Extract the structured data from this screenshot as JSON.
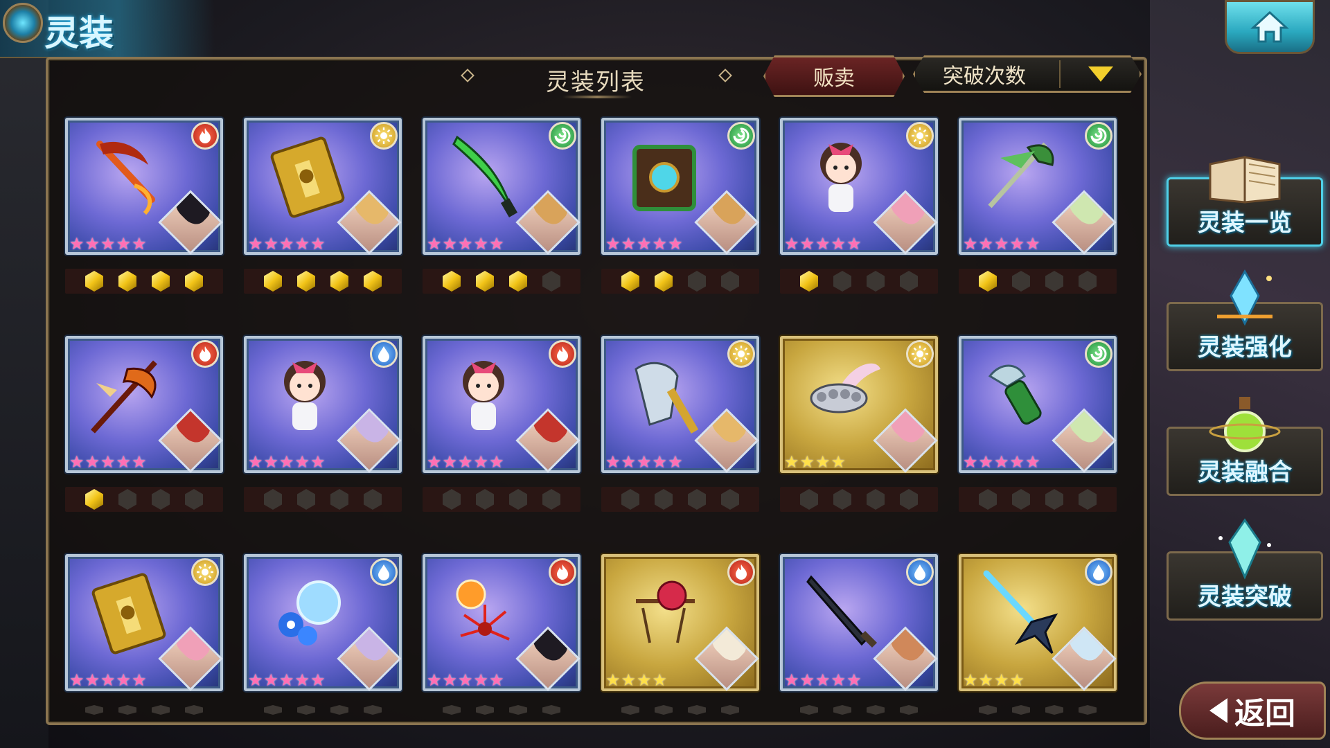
{
  "header": {
    "title": "灵装"
  },
  "list": {
    "title": "灵装列表",
    "sell_label": "贩卖",
    "sort_label": "突破次数"
  },
  "side_menu": [
    {
      "label": "灵装一览",
      "icon": "book-icon",
      "active": true
    },
    {
      "label": "灵装强化",
      "icon": "crystal-enhance-icon",
      "active": false
    },
    {
      "label": "灵装融合",
      "icon": "potion-flask-icon",
      "active": false
    },
    {
      "label": "灵装突破",
      "icon": "crystal-break-icon",
      "active": false
    }
  ],
  "back_label": "返回",
  "colors": {
    "fire": "#c73222",
    "light": "#e0a820",
    "wind": "#2a9a44",
    "water": "#2a6fd0",
    "gem": "#f2c418"
  },
  "cards": [
    {
      "item": "flame-scythe",
      "element": "fire",
      "rarity": 5,
      "frame": "purple",
      "breakthrough": 4,
      "hair": "#1e1a22"
    },
    {
      "item": "golden-tome",
      "element": "light",
      "rarity": 5,
      "frame": "purple",
      "breakthrough": 4,
      "hair": "#e6b86a"
    },
    {
      "item": "green-blade",
      "element": "wind",
      "rarity": 5,
      "frame": "purple",
      "breakthrough": 3,
      "hair": "#d9a35a"
    },
    {
      "item": "emerald-grimoire",
      "element": "wind",
      "rarity": 5,
      "frame": "purple",
      "breakthrough": 2,
      "hair": "#d9a35a"
    },
    {
      "item": "ribbon-doll",
      "element": "light",
      "rarity": 5,
      "frame": "purple",
      "breakthrough": 1,
      "hair": "#f0a0b8"
    },
    {
      "item": "jade-glaive",
      "element": "wind",
      "rarity": 5,
      "frame": "purple",
      "breakthrough": 1,
      "hair": "#cfe7b0"
    },
    {
      "item": "crimson-halberd",
      "element": "fire",
      "rarity": 5,
      "frame": "purple",
      "breakthrough": 1,
      "hair": "#c4352c"
    },
    {
      "item": "ribbon-doll",
      "element": "water",
      "rarity": 5,
      "frame": "purple",
      "breakthrough": 0,
      "hair": "#c9b4e6"
    },
    {
      "item": "ribbon-doll",
      "element": "fire",
      "rarity": 5,
      "frame": "purple",
      "breakthrough": 0,
      "hair": "#c4352c"
    },
    {
      "item": "golden-gauntlet",
      "element": "light",
      "rarity": 5,
      "frame": "purple",
      "breakthrough": 0,
      "hair": "#e6b86a"
    },
    {
      "item": "winged-knuckles",
      "element": "light",
      "rarity": 4,
      "frame": "gold",
      "breakthrough": 0,
      "hair": "#f0a0b8"
    },
    {
      "item": "shark-blaster",
      "element": "wind",
      "rarity": 5,
      "frame": "purple",
      "breakthrough": 0,
      "hair": "#cfe7b0"
    },
    {
      "item": "golden-tome",
      "element": "light",
      "rarity": 5,
      "frame": "purple",
      "breakthrough": null,
      "hair": "#f0a0b8"
    },
    {
      "item": "morning-glory-orb",
      "element": "water",
      "rarity": 5,
      "frame": "purple",
      "breakthrough": null,
      "hair": "#c9b4e6"
    },
    {
      "item": "spider-lily-orb",
      "element": "fire",
      "rarity": 5,
      "frame": "purple",
      "breakthrough": null,
      "hair": "#1e1a22"
    },
    {
      "item": "rose-staff",
      "element": "fire",
      "rarity": 4,
      "frame": "gold",
      "breakthrough": null,
      "hair": "#f3ead8"
    },
    {
      "item": "dark-greatsword",
      "element": "water",
      "rarity": 5,
      "frame": "purple",
      "breakthrough": null,
      "hair": "#d0885a"
    },
    {
      "item": "ice-spear",
      "element": "water",
      "rarity": 4,
      "frame": "gold",
      "breakthrough": null,
      "hair": "#cfe6f5"
    }
  ]
}
